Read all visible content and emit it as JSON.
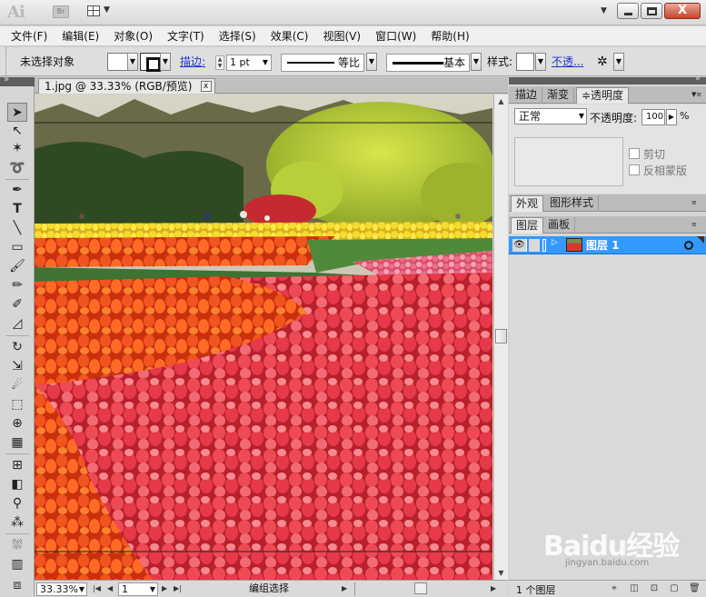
{
  "app": {
    "logo": "Ai",
    "bridge_label": "Br"
  },
  "window_controls": {
    "minimize": "—",
    "maximize": "□",
    "close": "X"
  },
  "menubar": {
    "items": [
      "文件(F)",
      "编辑(E)",
      "对象(O)",
      "文字(T)",
      "选择(S)",
      "效果(C)",
      "视图(V)",
      "窗口(W)",
      "帮助(H)"
    ]
  },
  "controlbar": {
    "selection_status": "未选择对象",
    "stroke_label": "描边:",
    "stroke_weight": "1 pt",
    "profile_label": "等比",
    "brush_label": "基本",
    "style_label": "样式:",
    "opacity_link": "不透..."
  },
  "document": {
    "tab_title": "1.jpg @ 33.33% (RGB/预览)",
    "tab_close": "x"
  },
  "statusbar": {
    "zoom": "33.33%",
    "artboard": "1",
    "tool_status": "编组选择"
  },
  "panel_transparency": {
    "tabs": [
      "描边",
      "渐变",
      "≑透明度"
    ],
    "blend_mode": "正常",
    "opacity_label": "不透明度:",
    "opacity_value": "100",
    "opacity_unit": "%",
    "clip_label": "剪切",
    "invert_mask_label": "反相蒙版"
  },
  "panel_appearance": {
    "tabs": [
      "外观",
      "图形样式"
    ]
  },
  "panel_layers": {
    "tabs": [
      "图层",
      "画板"
    ],
    "layer_name": "图层 1",
    "layer_count": "1 个图层"
  },
  "watermark": {
    "text": "Baidu经验",
    "url": "jingyan.baidu.com"
  },
  "colors": {
    "selection_blue": "#3399ff",
    "tulip_red": "#e8383d",
    "tulip_orange": "#f0501f"
  }
}
